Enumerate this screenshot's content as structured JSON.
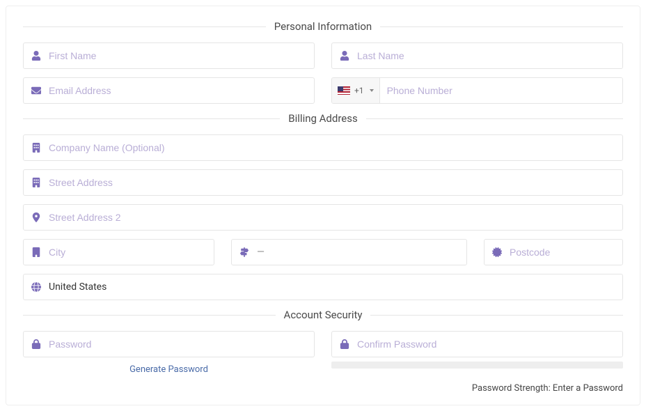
{
  "sections": {
    "personal": {
      "title": "Personal Information",
      "first_name": {
        "placeholder": "First Name",
        "value": ""
      },
      "last_name": {
        "placeholder": "Last Name",
        "value": ""
      },
      "email": {
        "placeholder": "Email Address",
        "value": ""
      },
      "phone": {
        "placeholder": "Phone Number",
        "value": "",
        "dial_code": "+1"
      }
    },
    "billing": {
      "title": "Billing Address",
      "company": {
        "placeholder": "Company Name (Optional)",
        "value": ""
      },
      "street1": {
        "placeholder": "Street Address",
        "value": ""
      },
      "street2": {
        "placeholder": "Street Address 2",
        "value": ""
      },
      "city": {
        "placeholder": "City",
        "value": ""
      },
      "state": {
        "placeholder": "—",
        "value": ""
      },
      "postcode": {
        "placeholder": "Postcode",
        "value": ""
      },
      "country": {
        "value": "United States"
      }
    },
    "security": {
      "title": "Account Security",
      "password": {
        "placeholder": "Password",
        "value": ""
      },
      "confirm": {
        "placeholder": "Confirm Password",
        "value": ""
      },
      "generate_label": "Generate Password",
      "strength_label": "Password Strength: Enter a Password"
    }
  }
}
